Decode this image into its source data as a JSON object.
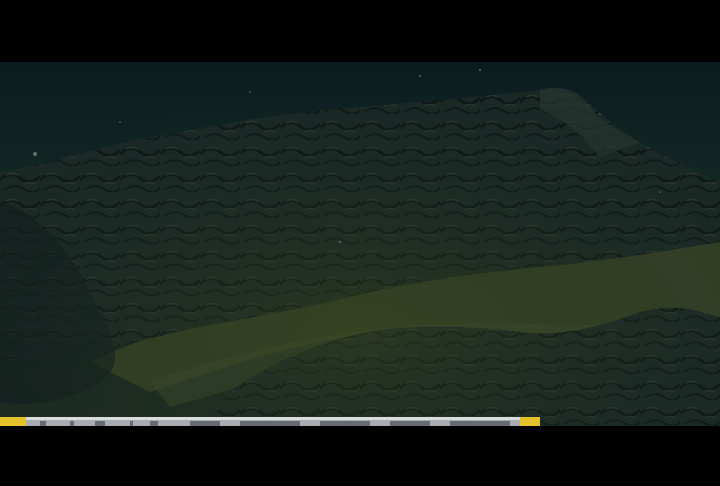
{
  "scene": {
    "subject": "seafloor-lava-flow",
    "colors": {
      "water": "#0f2323",
      "water_deep": "#0a1a1c",
      "sediment": "#3f4a26",
      "sediment_light": "#4c5630",
      "lava": "#1e2c28",
      "lava_shadow": "#101a18",
      "lava_highlight": "#2d3a33",
      "letterbox": "#000000",
      "bar_silver": "#b9bcc0",
      "bar_yellow": "#e3c22a"
    }
  }
}
